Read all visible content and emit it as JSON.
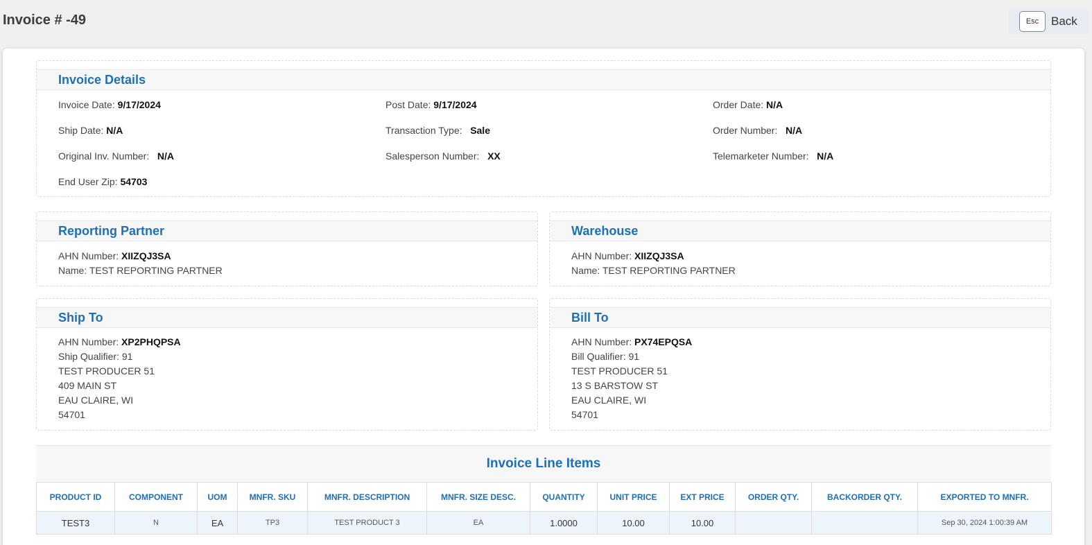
{
  "page": {
    "title": "Invoice # -49"
  },
  "back_button": {
    "key": "Esc",
    "label": "Back"
  },
  "invoice_details": {
    "title": "Invoice Details",
    "fields": [
      {
        "label": "Invoice Date:",
        "value": "9/17/2024"
      },
      {
        "label": "Post Date:",
        "value": "9/17/2024"
      },
      {
        "label": "Order Date:",
        "value": "N/A"
      },
      {
        "label": "Ship Date:",
        "value": "N/A"
      },
      {
        "label": "Transaction Type:",
        "value": "Sale"
      },
      {
        "label": "Order Number:",
        "value": "N/A"
      },
      {
        "label": "Original Inv. Number:",
        "value": "N/A"
      },
      {
        "label": "Salesperson Number:",
        "value": "XX"
      },
      {
        "label": "Telemarketer Number:",
        "value": "N/A"
      },
      {
        "label": "End User Zip:",
        "value": "54703"
      }
    ]
  },
  "reporting_partner": {
    "title": "Reporting Partner",
    "ahn_label": "AHN Number:",
    "ahn_value": "XIIZQJ3SA",
    "name_line": "Name: TEST REPORTING PARTNER"
  },
  "warehouse": {
    "title": "Warehouse",
    "ahn_label": "AHN Number:",
    "ahn_value": "XIIZQJ3SA",
    "name_line": "Name: TEST REPORTING PARTNER"
  },
  "ship_to": {
    "title": "Ship To",
    "ahn_label": "AHN Number:",
    "ahn_value": "XP2PHQPSA",
    "lines": [
      "Ship Qualifier: 91",
      "TEST PRODUCER 51",
      "409 MAIN ST",
      "EAU CLAIRE, WI",
      "54701"
    ]
  },
  "bill_to": {
    "title": "Bill To",
    "ahn_label": "AHN Number:",
    "ahn_value": "PX74EPQSA",
    "lines": [
      "Bill Qualifier: 91",
      "TEST PRODUCER 51",
      "13 S BARSTOW ST",
      "EAU CLAIRE, WI",
      "54701"
    ]
  },
  "line_items": {
    "title": "Invoice Line Items",
    "columns": [
      "PRODUCT ID",
      "COMPONENT",
      "UOM",
      "MNFR. SKU",
      "MNFR. DESCRIPTION",
      "MNFR. SIZE DESC.",
      "QUANTITY",
      "UNIT PRICE",
      "EXT PRICE",
      "ORDER QTY.",
      "BACKORDER QTY.",
      "EXPORTED TO MNFR."
    ],
    "rows": [
      [
        "TEST3",
        "N",
        "EA",
        "TP3",
        "TEST PRODUCT 3",
        "EA",
        "1.0000",
        "10.00",
        "10.00",
        "",
        "",
        "Sep 30, 2024 1:00:39 AM"
      ]
    ]
  }
}
